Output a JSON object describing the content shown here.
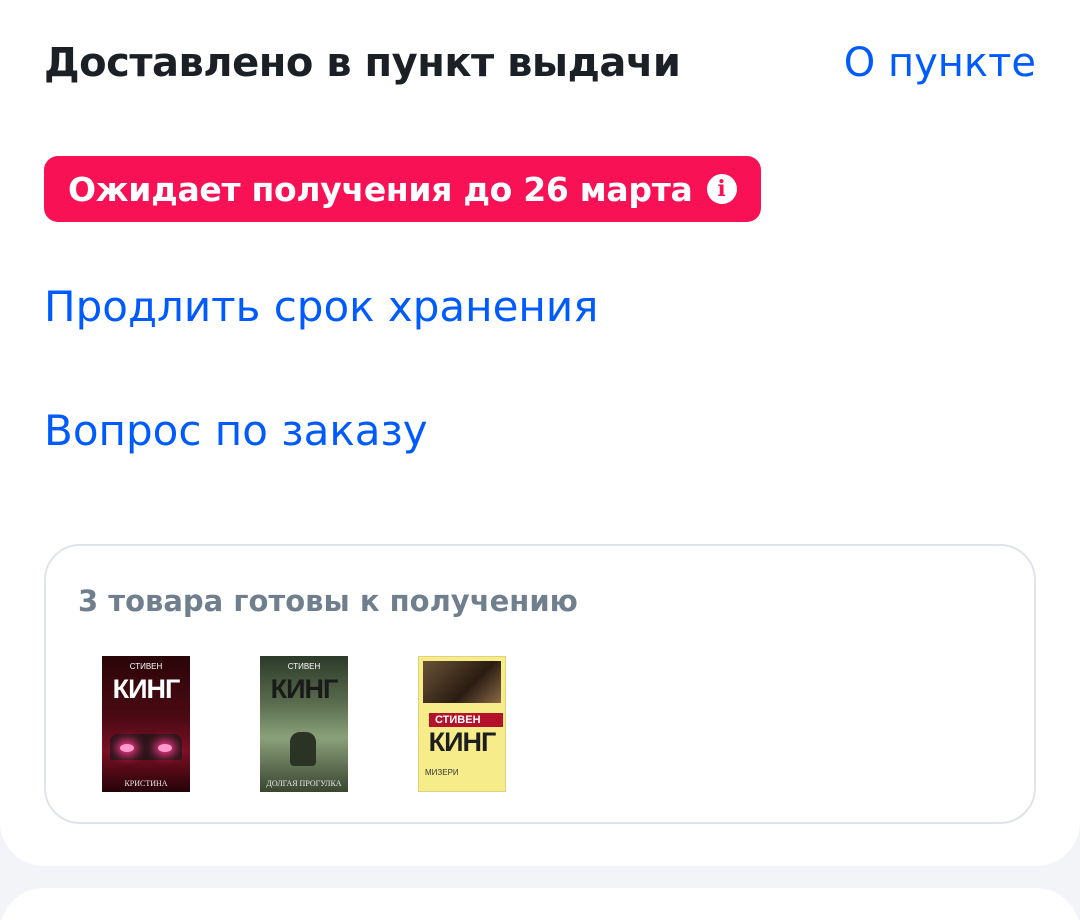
{
  "order": {
    "status_title": "Доставлено в пункт выдачи",
    "about_point_link": "О пункте",
    "badge": {
      "text": "Ожидает получения до 26 марта",
      "icon": "info-icon",
      "color": "#f91155"
    },
    "actions": {
      "extend_storage": "Продлить срок хранения",
      "order_question": "Вопрос по заказу"
    },
    "items": {
      "caption": "3 товара готовы к получению",
      "books": [
        {
          "author": "СТИВЕН",
          "name": "КИНГ",
          "subtitle": "КРИСТИНА"
        },
        {
          "author": "СТИВЕН",
          "name": "КИНГ",
          "subtitle": "ДОЛГАЯ ПРОГУЛКА"
        },
        {
          "author": "СТИВЕН",
          "name": "КИНГ",
          "subtitle": "МИЗЕРИ"
        }
      ]
    }
  },
  "colors": {
    "link": "#005bff",
    "title": "#1b1f26",
    "caption": "#707f8d",
    "background": "#f2f4f7"
  }
}
